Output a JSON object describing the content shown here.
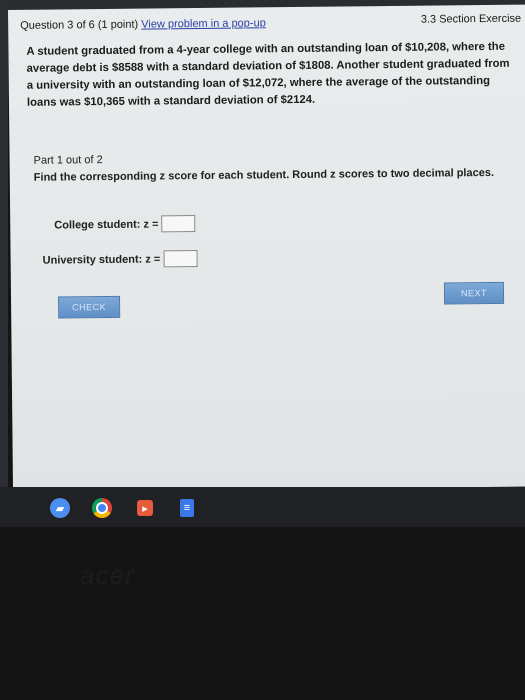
{
  "header": {
    "question_counter": "Question 3 of 6",
    "points": "(1 point)",
    "popup_link": "View problem in a pop-up",
    "section_title": "3.3 Section Exercise"
  },
  "problem": {
    "text": "A student graduated from a 4-year college with an outstanding loan of $10,208, where the average debt is $8588 with a standard deviation of $1808. Another student graduated from a university with an outstanding loan of $12,072, where the average of the outstanding loans was $10,365 with a standard deviation of $2124."
  },
  "part": {
    "label": "Part 1 out of 2",
    "instructions": "Find the corresponding z score for each student. Round z scores to two decimal places."
  },
  "inputs": {
    "college_label": "College student: z =",
    "college_value": "",
    "university_label": "University student: z =",
    "university_value": ""
  },
  "buttons": {
    "check": "CHECK",
    "next": "NEXT"
  },
  "dock": {
    "icons": [
      "files-icon",
      "chrome-icon",
      "play-store-icon",
      "docs-icon"
    ],
    "brand": "acer"
  }
}
